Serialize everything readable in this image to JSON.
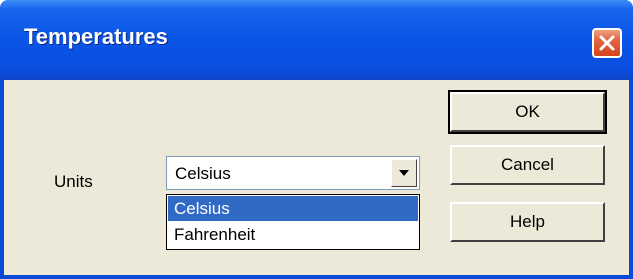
{
  "window": {
    "title": "Temperatures"
  },
  "form": {
    "units_label": "Units",
    "units_selected": "Celsius",
    "units_options": [
      "Celsius",
      "Fahrenheit"
    ],
    "highlighted_option": "Celsius"
  },
  "buttons": {
    "ok": "OK",
    "cancel": "Cancel",
    "help": "Help"
  },
  "icons": {
    "close": "close-icon",
    "dropdown": "chevron-down-icon"
  },
  "colors": {
    "titlebar": "#0b55e6",
    "close_button": "#e2643e",
    "dialog_face": "#ece9d8",
    "selection": "#316ac5"
  }
}
